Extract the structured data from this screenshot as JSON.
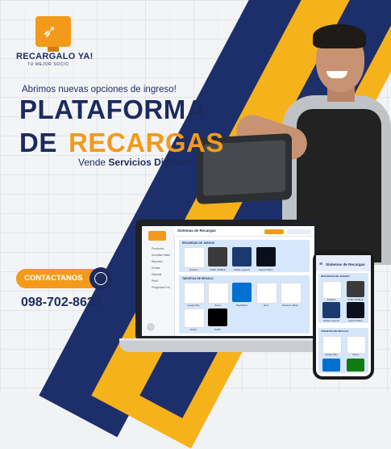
{
  "brand": {
    "name": "RECARGALO YA!",
    "tagline": "TU MEJOR SOCIO"
  },
  "headline": {
    "intro": "Abrimos nuevas opciones de ingreso!",
    "line1": "PLATAFORMA",
    "line2_prefix": "DE",
    "line2_highlight": "RECARGAS",
    "subline_prefix": "Vende",
    "subline_bold": "Servicios Digitales!"
  },
  "contact": {
    "cta_label": "CONTACTANOS",
    "phone": "098-702-8630",
    "whatsapp_icon": "whatsapp-icon"
  },
  "laptop_app": {
    "title": "Sistemas de Recargas",
    "menu": [
      "Productos",
      "Acreditar Saldo",
      "Reportes",
      "Ventas",
      "Historial",
      "Perfil",
      "Preguntas Frec"
    ],
    "section_games": "RECARGAS DE JUEGOS",
    "section_cards": "TARJETAS DE REGALO",
    "games": [
      "FreeFire",
      "PUBG MOBILE",
      "Mobile Legends",
      "Speed Drifters"
    ],
    "cards": [
      "Google Play",
      "iTunes",
      "PlayStation",
      "Xbox",
      "Nintendo eShop",
      "Roblox",
      "Netflix"
    ]
  },
  "phone_app": {
    "title": "Sistemas de Recargas",
    "section_games": "RECARGAS DE JUEGOS",
    "section_cards": "TARJETAS DE REGALO",
    "games": [
      "FreeFire",
      "PUBG MOBILE",
      "Mobile Legends",
      "Speed Drifters"
    ],
    "cards": [
      "Google Play",
      "iTunes"
    ]
  },
  "colors": {
    "navy": "#1c2b5e",
    "orange": "#f39a1b",
    "yellow": "#f6b21a"
  }
}
